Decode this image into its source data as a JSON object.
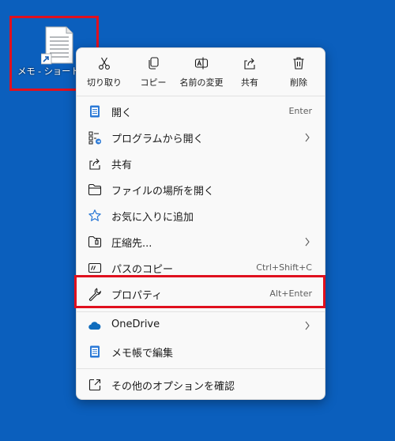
{
  "desktop": {
    "shortcut_label": "メモ - ショートカット"
  },
  "toolbar": {
    "cut": "切り取り",
    "copy": "コピー",
    "rename": "名前の変更",
    "share": "共有",
    "delete": "削除"
  },
  "menu": {
    "open": {
      "label": "開く",
      "shortcut": "Enter"
    },
    "open_with": {
      "label": "プログラムから開く"
    },
    "share": {
      "label": "共有"
    },
    "open_location": {
      "label": "ファイルの場所を開く"
    },
    "add_favorite": {
      "label": "お気に入りに追加"
    },
    "compress": {
      "label": "圧縮先..."
    },
    "copy_path": {
      "label": "パスのコピー",
      "shortcut": "Ctrl+Shift+C"
    },
    "properties": {
      "label": "プロパティ",
      "shortcut": "Alt+Enter"
    },
    "onedrive": {
      "label": "OneDrive"
    },
    "edit_notepad": {
      "label": "メモ帳で編集"
    },
    "more_options": {
      "label": "その他のオプションを確認"
    }
  },
  "colors": {
    "desktop_bg": "#0b5fbd",
    "highlight_border": "#e0101e",
    "menu_bg": "#f9f9f9",
    "accent": "#0067c0"
  }
}
